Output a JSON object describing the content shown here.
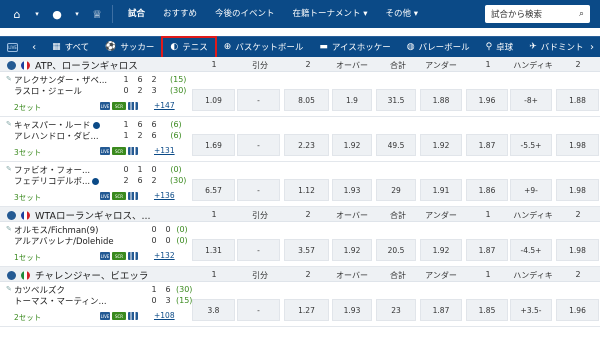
{
  "topnav": {
    "items": [
      "試合",
      "おすすめ",
      "今後のイベント",
      "在籍トーナメント",
      "その他"
    ],
    "search_label": "試合から検索"
  },
  "sports": {
    "live_label": "LIVE",
    "items": [
      {
        "label": "すべて",
        "icon": "grid-icon"
      },
      {
        "label": "サッカー",
        "icon": "soccer-icon"
      },
      {
        "label": "テニス",
        "icon": "tennis-icon",
        "active": true
      },
      {
        "label": "バスケットボール",
        "icon": "basketball-icon"
      },
      {
        "label": "アイスホッケー",
        "icon": "hockey-icon"
      },
      {
        "label": "バレーボール",
        "icon": "volleyball-icon"
      },
      {
        "label": "卓球",
        "icon": "table-tennis-icon"
      },
      {
        "label": "バドミントン",
        "icon": "badminton-icon"
      }
    ]
  },
  "columns": [
    "1",
    "引分",
    "2",
    "オーバー",
    "合計",
    "アンダー",
    "1",
    "ハンディキ",
    "2"
  ],
  "leagues": [
    {
      "name": "ATP、ローランギャロス",
      "flag": "france",
      "matches": [
        {
          "p1": "アレクサンダー・ザベ...",
          "p2": "ラスロ・ジェール",
          "s1": [
            "1",
            "6",
            "2",
            "(15)"
          ],
          "s2": [
            "0",
            "2",
            "3",
            "(30)"
          ],
          "set": "2セット",
          "more": "+147",
          "odds": [
            "1.09",
            "-",
            "8.05",
            "1.9",
            "31.5",
            "1.88",
            "1.96",
            "-8+",
            "1.88"
          ]
        },
        {
          "p1": "キャスパー・ルード",
          "p2": "アレハンドロ・ダビ...",
          "s1": [
            "1",
            "6",
            "6",
            "(6)"
          ],
          "s2": [
            "1",
            "2",
            "6",
            "(6)"
          ],
          "set": "3セット",
          "more": "+131",
          "odds": [
            "1.69",
            "-",
            "2.23",
            "1.92",
            "49.5",
            "1.92",
            "1.87",
            "-5.5+",
            "1.98"
          ]
        },
        {
          "p1": "ファビオ・フォー...",
          "p2": "フェデリコデルボ...",
          "s1": [
            "0",
            "1",
            "0",
            "(0)"
          ],
          "s2": [
            "2",
            "6",
            "2",
            "(30)"
          ],
          "set": "3セット",
          "more": "+136",
          "odds": [
            "6.57",
            "-",
            "1.12",
            "1.93",
            "29",
            "1.91",
            "1.86",
            "+9-",
            "1.98"
          ]
        }
      ]
    },
    {
      "name": "WTAローランギャロス、...",
      "flag": "france",
      "matches": [
        {
          "p1": "オルモス/Fichman(9)",
          "p2": "アルアバッレナ/Dolehide",
          "s1": [
            "0",
            "0",
            "(0)"
          ],
          "s2": [
            "0",
            "0",
            "(0)"
          ],
          "set": "1セット",
          "more": "+132",
          "odds": [
            "1.31",
            "-",
            "3.57",
            "1.92",
            "20.5",
            "1.92",
            "1.87",
            "-4.5+",
            "1.98"
          ]
        }
      ]
    },
    {
      "name": "チャレンジャー、ビエッラ",
      "flag": "italy",
      "matches": [
        {
          "p1": "カツベルズク",
          "p2": "トーマス・マーティン...",
          "s1": [
            "1",
            "6",
            "(30)"
          ],
          "s2": [
            "0",
            "3",
            "(15)"
          ],
          "set": "2セット",
          "more": "+108",
          "odds": [
            "3.8",
            "-",
            "1.27",
            "1.93",
            "23",
            "1.87",
            "1.85",
            "+3.5-",
            "1.96"
          ]
        }
      ]
    }
  ],
  "colors": {
    "nav_bg": "#0b4a87",
    "active_outline": "#e01a1a",
    "score_green": "#3a8a1e"
  }
}
